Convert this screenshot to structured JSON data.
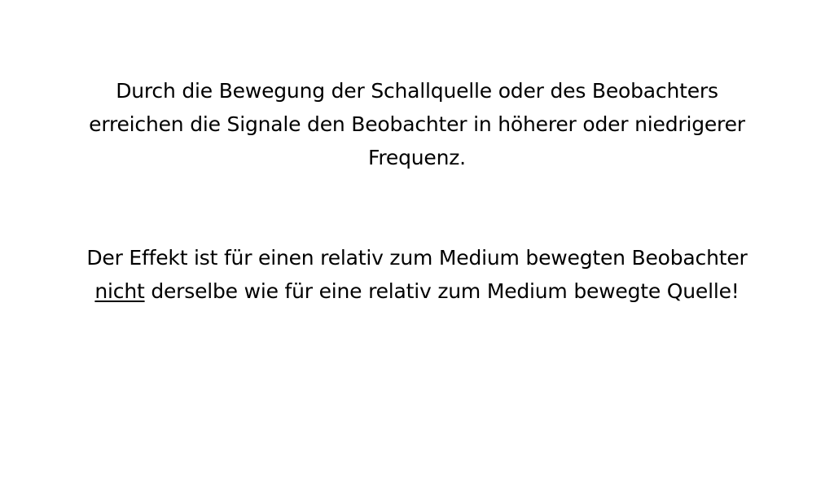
{
  "paragraph_1": {
    "line_1": "Durch die Bewegung der Schallquelle oder des Beobachters",
    "line_2": "erreichen die Signale den Beobachter in höherer oder niedrigerer",
    "line_3": "Frequenz."
  },
  "paragraph_2": {
    "line_1": "Der Effekt ist für einen relativ zum Medium bewegten Beobachter",
    "line_2_emphasis": "nicht",
    "line_2_rest": " derselbe wie für eine relativ zum Medium bewegte Quelle!"
  }
}
